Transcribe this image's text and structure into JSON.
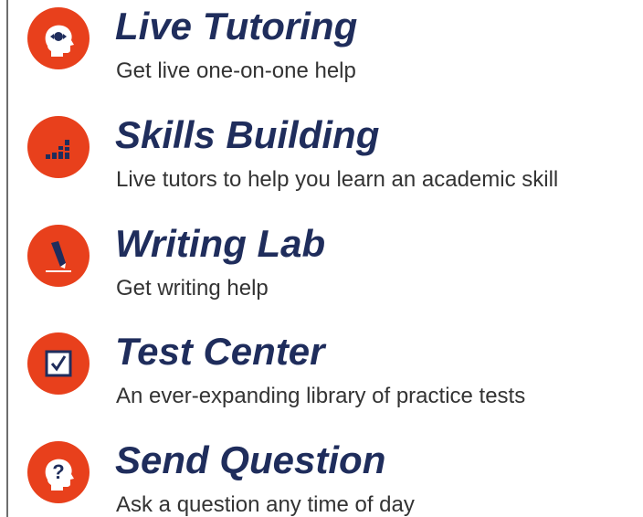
{
  "menu": {
    "items": [
      {
        "icon": "tutor-head-icon",
        "title": "Live Tutoring",
        "description": "Get live one-on-one help"
      },
      {
        "icon": "bar-chart-icon",
        "title": "Skills Building",
        "description": "Live tutors to help you learn an academic skill"
      },
      {
        "icon": "pen-writing-icon",
        "title": "Writing Lab",
        "description": "Get writing help"
      },
      {
        "icon": "checkbox-icon",
        "title": "Test Center",
        "description": "An ever-expanding library of practice tests"
      },
      {
        "icon": "question-head-icon",
        "title": "Send Question",
        "description": "Ask a question any time of day"
      }
    ]
  },
  "colors": {
    "accent": "#e8401c",
    "title": "#1f2d5c",
    "description": "#333333",
    "border": "#6e6e6e"
  }
}
